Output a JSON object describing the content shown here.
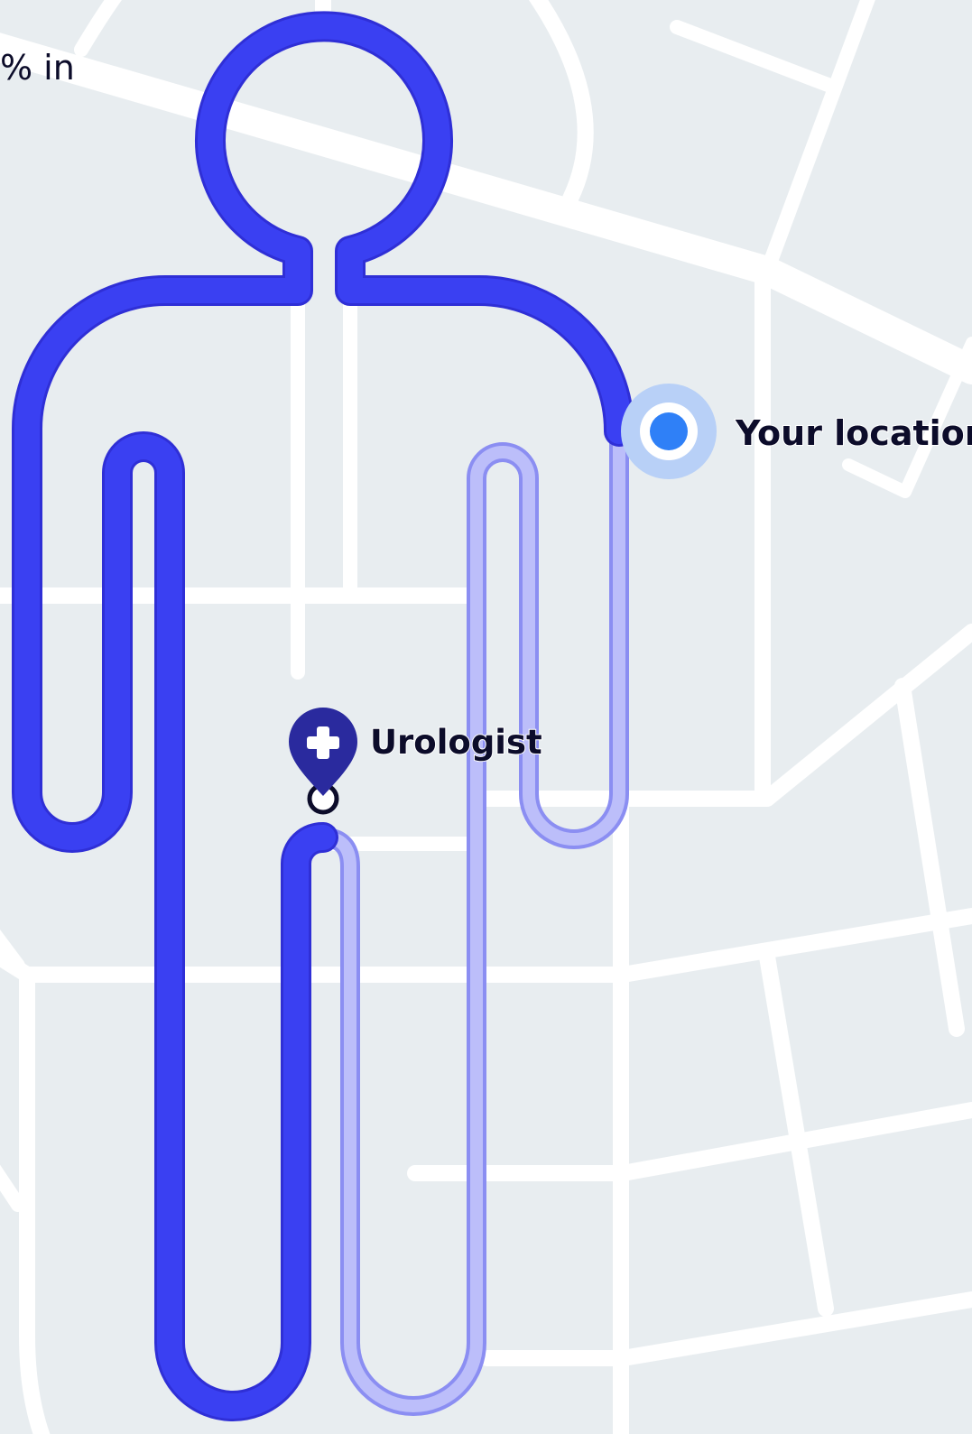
{
  "corner_text": "% in",
  "markers": {
    "your_location": {
      "label": "Your location",
      "dot_color": "#2f80f7",
      "halo_color": "#b8d0f7"
    },
    "urologist": {
      "label": "Urologist",
      "icon": "medical-cross-icon",
      "pin_color": "#2a2a9e"
    }
  },
  "colors": {
    "map_background": "#e8edf0",
    "roads": "#ffffff",
    "route_traveled": "#3a40f2",
    "route_remaining": "#bcbefa",
    "route_remaining_outline": "#8b8ef2"
  }
}
